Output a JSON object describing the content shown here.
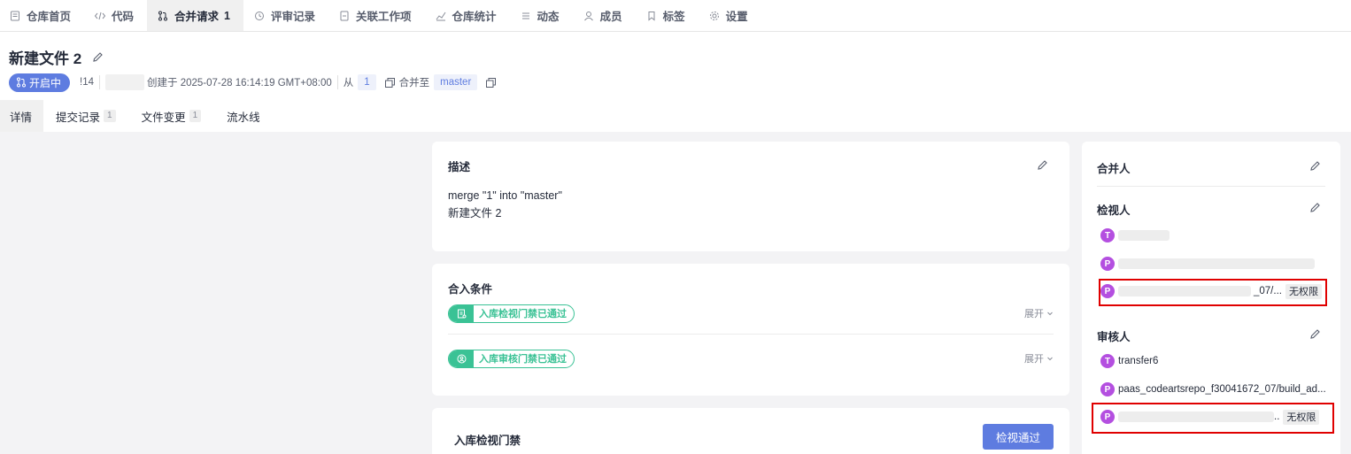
{
  "topnav": [
    {
      "label": "仓库首页",
      "icon": "document-icon",
      "active": false
    },
    {
      "label": "代码",
      "icon": "code-icon",
      "active": false
    },
    {
      "label": "合并请求",
      "count": "1",
      "icon": "merge-request-icon",
      "active": true
    },
    {
      "label": "评审记录",
      "icon": "review-icon",
      "active": false
    },
    {
      "label": "关联工作项",
      "icon": "work-item-icon",
      "active": false
    },
    {
      "label": "仓库统计",
      "icon": "stats-icon",
      "active": false
    },
    {
      "label": "动态",
      "icon": "activity-icon",
      "active": false
    },
    {
      "label": "成员",
      "icon": "member-icon",
      "active": false
    },
    {
      "label": "标签",
      "icon": "tag-icon",
      "active": false
    },
    {
      "label": "设置",
      "icon": "gear-icon",
      "active": false
    }
  ],
  "header": {
    "title": "新建文件 2",
    "status": "开启中",
    "mr_id": "!14",
    "created_at": "创建于 2025-07-28 16:14:19 GMT+08:00",
    "from_label": "从",
    "source_branch": "1",
    "merge_to_label": "合并至",
    "target_branch": "master"
  },
  "subtabs": [
    {
      "label": "详情",
      "active": true
    },
    {
      "label": "提交记录",
      "badge": "1"
    },
    {
      "label": "文件变更",
      "badge": "1"
    },
    {
      "label": "流水线"
    }
  ],
  "description": {
    "title": "描述",
    "lines": [
      "merge \"1\" into \"master\"",
      "新建文件 2"
    ]
  },
  "conditions": {
    "title": "合入条件",
    "items": [
      {
        "label": "入库检视门禁已通过",
        "expand": "展开"
      },
      {
        "label": "入库审核门禁已通过",
        "expand": "展开"
      }
    ]
  },
  "review_gate": {
    "title": "入库检视门禁",
    "button": "检视通过"
  },
  "sidebar": {
    "merger": {
      "title": "合并人"
    },
    "reviewers": {
      "title": "检视人",
      "people": [
        {
          "initial": "T",
          "name": ""
        },
        {
          "initial": "P",
          "name": ""
        },
        {
          "initial": "P",
          "name": "_07/...",
          "tag": "无权限"
        }
      ]
    },
    "approvers": {
      "title": "审核人",
      "people": [
        {
          "initial": "T",
          "name": "transfer6"
        },
        {
          "initial": "P",
          "name": "paas_codeartsrepo_f30041672_07/build_ad..."
        },
        {
          "initial": "P",
          "name": "..",
          "tag": "无权限"
        }
      ]
    }
  },
  "colors": {
    "primary": "#5e7ce0",
    "success": "#3ac295",
    "avatar": "#b44fe0",
    "highlight": "#e00000"
  }
}
